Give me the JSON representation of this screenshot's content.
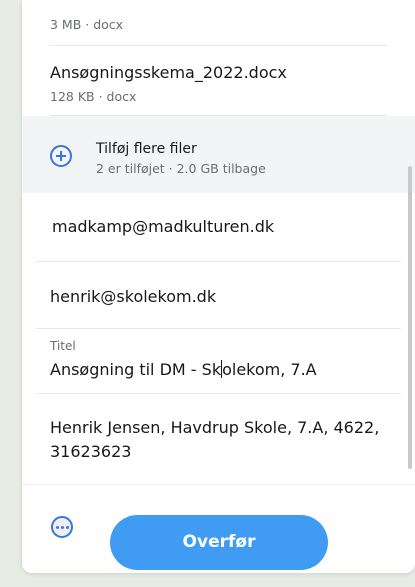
{
  "files": [
    {
      "name": "",
      "meta": "3 MB · docx"
    },
    {
      "name": "Ansøgningsskema_2022.docx",
      "meta": "128 KB · docx"
    }
  ],
  "add_files": {
    "label": "Tilføj flere filer",
    "meta": "2 er tilføjet · 2.0 GB tilbage",
    "icon": "plus-circle-icon"
  },
  "form": {
    "to": "madkamp@madkulturen.dk",
    "from": "henrik@skolekom.dk",
    "title_label": "Titel",
    "title_before_cursor": "Ansøgning til DM - Sk",
    "title_after_cursor": "olekom, 7.A",
    "message": "Henrik Jensen, Havdrup Skole, 7.A, 4622, 31623623"
  },
  "footer": {
    "more_icon": "more-options-icon",
    "transfer_label": "Overfør"
  },
  "colors": {
    "accent": "#3874e3",
    "button": "#409cf3",
    "background": "#e6ece3"
  }
}
